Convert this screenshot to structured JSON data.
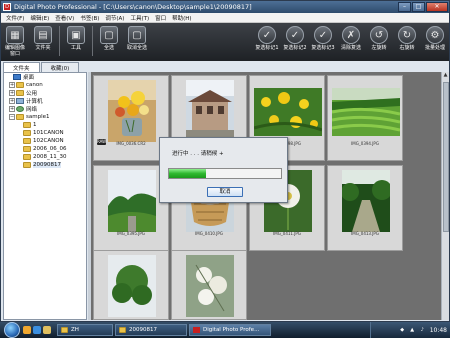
{
  "window": {
    "title": "Digital Photo Professional - [C:\\Users\\canon\\Desktop\\sample1\\20090817]",
    "app_icon_glyph": "D",
    "controls": {
      "minimize": "–",
      "maximize": "□",
      "close": "✕"
    }
  },
  "menu": [
    "文件(F)",
    "编辑(E)",
    "查看(V)",
    "书签(B)",
    "调节(A)",
    "工具(T)",
    "窗口",
    "帮助(H)"
  ],
  "toolbar": {
    "left": [
      {
        "label": "编辑图像\n窗口",
        "icon": "edit-window-icon",
        "glyph": "▦"
      },
      {
        "label": "文件夹",
        "icon": "folder-icon",
        "glyph": "▤"
      },
      {
        "label": "工具",
        "icon": "tool-palette-icon",
        "glyph": "▣"
      },
      {
        "label": "全选",
        "icon": "select-all-icon",
        "glyph": "▢"
      },
      {
        "label": "取消全选",
        "icon": "deselect-all-icon",
        "glyph": "▢"
      }
    ],
    "right": [
      {
        "label": "复选标记1",
        "icon": "check-mark-1-icon",
        "glyph": "✓"
      },
      {
        "label": "复选标记2",
        "icon": "check-mark-2-icon",
        "glyph": "✓"
      },
      {
        "label": "复选标记3",
        "icon": "check-mark-3-icon",
        "glyph": "✓"
      },
      {
        "label": "清除复选",
        "icon": "clear-check-icon",
        "glyph": "✗"
      },
      {
        "label": "左旋转",
        "icon": "rotate-left-icon",
        "glyph": "↺"
      },
      {
        "label": "右旋转",
        "icon": "rotate-right-icon",
        "glyph": "↻"
      },
      {
        "label": "批量处理",
        "icon": "batch-process-icon",
        "glyph": "⚙"
      }
    ]
  },
  "tabs": [
    "文件夹",
    "收藏(0)"
  ],
  "tree": [
    {
      "label": "桌面",
      "level": 0,
      "expander": "",
      "icon": "desktop"
    },
    {
      "label": "canon",
      "level": 1,
      "expander": "+",
      "icon": "folder"
    },
    {
      "label": "公用",
      "level": 1,
      "expander": "+",
      "icon": "folder"
    },
    {
      "label": "计算机",
      "level": 1,
      "expander": "+",
      "icon": "pc"
    },
    {
      "label": "网络",
      "level": 1,
      "expander": "+",
      "icon": "net"
    },
    {
      "label": "sample1",
      "level": 1,
      "expander": "−",
      "icon": "folder"
    },
    {
      "label": "1",
      "level": 2,
      "expander": "",
      "icon": "folder"
    },
    {
      "label": "101CANON",
      "level": 2,
      "expander": "",
      "icon": "folder"
    },
    {
      "label": "102CANON",
      "level": 2,
      "expander": "",
      "icon": "folder"
    },
    {
      "label": "2006_06_06",
      "level": 2,
      "expander": "",
      "icon": "folder"
    },
    {
      "label": "2008_11_30",
      "level": 2,
      "expander": "",
      "icon": "folder"
    },
    {
      "label": "20090817",
      "level": 2,
      "expander": "",
      "icon": "folder",
      "selected": true
    }
  ],
  "thumbnails": [
    {
      "caption": "IMG_0036.CR2",
      "scene": "flowers",
      "camera_badge": "RAW"
    },
    {
      "caption": "IMG_0037.JPG",
      "scene": "building",
      "camera_badge": ""
    },
    {
      "caption": "IMG_0398.JPG",
      "scene": "yellow-flowers",
      "camera_badge": ""
    },
    {
      "caption": "IMG_0394.JPG",
      "scene": "tea-field",
      "camera_badge": ""
    },
    {
      "caption": "IMG_0395.JPG",
      "scene": "trees-sky",
      "camera_badge": ""
    },
    {
      "caption": "IMG_0410.JPG",
      "scene": "basket",
      "camera_badge": ""
    },
    {
      "caption": "IMG_0411.JPG",
      "scene": "white-flower",
      "camera_badge": ""
    },
    {
      "caption": "IMG_0413.JPG",
      "scene": "forest-path",
      "camera_badge": ""
    },
    {
      "caption": "",
      "scene": "tree-top",
      "camera_badge": ""
    },
    {
      "caption": "",
      "scene": "white-blossom",
      "camera_badge": ""
    }
  ],
  "dialog": {
    "message": "进行中 . . . 请稍候 +",
    "progress": 0.33,
    "cancel_label": "取消"
  },
  "taskbar": {
    "tasks": [
      {
        "label": "ZH",
        "active": false
      },
      {
        "label": "20090817",
        "active": false
      },
      {
        "label": "Digital Photo Profe...",
        "active": true
      }
    ],
    "clock": "10:48"
  },
  "colors": {
    "progress_fill": "#2fb82f",
    "toolbar_bg": "#2a2d31",
    "thumb_panel_bg": "#6f6f6f"
  }
}
